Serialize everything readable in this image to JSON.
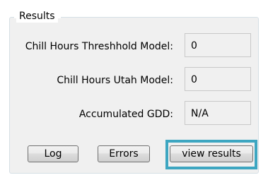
{
  "group": {
    "title": "Results"
  },
  "rows": [
    {
      "label": "Chill Hours Threshhold Model:",
      "value": "0"
    },
    {
      "label": "Chill Hours Utah Model:",
      "value": "0"
    },
    {
      "label": "Accumulated GDD:",
      "value": "N/A"
    }
  ],
  "buttons": {
    "log_label": "Log",
    "errors_label": "Errors",
    "view_results_label": "view results"
  },
  "colors": {
    "highlight": "#3da6c1",
    "panel": "#f0f0f0"
  }
}
